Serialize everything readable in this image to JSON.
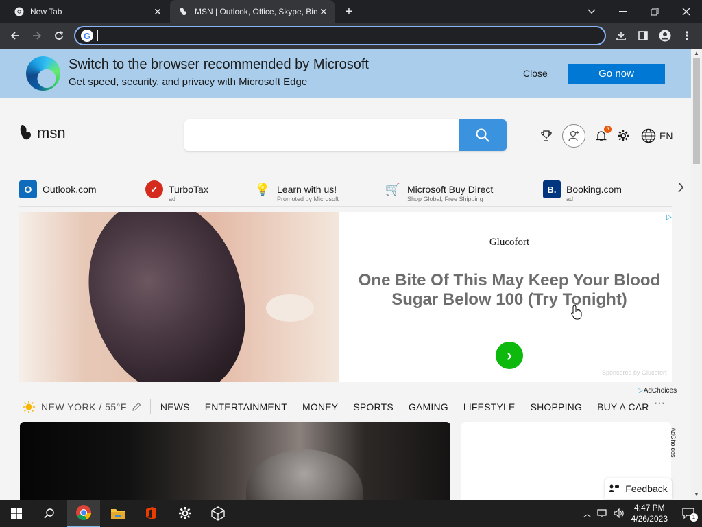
{
  "browser": {
    "tabs": [
      {
        "label": "New Tab",
        "active": false
      },
      {
        "label": "MSN | Outlook, Office, Skype, Bing",
        "active": true
      }
    ],
    "omnibox": {
      "value": "",
      "placeholder": ""
    }
  },
  "edge_banner": {
    "title": "Switch to the browser recommended by Microsoft",
    "subtitle": "Get speed, security, and privacy with Microsoft Edge",
    "close_label": "Close",
    "go_label": "Go now"
  },
  "msn": {
    "logo_text": "msn",
    "search": {
      "value": "",
      "placeholder": ""
    },
    "notification_count": "5",
    "language": "EN"
  },
  "quick_links": [
    {
      "title": "Outlook.com",
      "sub": "",
      "icon_text": "O",
      "icon_color": "#0f6cbd"
    },
    {
      "title": "TurboTax",
      "sub": "ad",
      "icon_text": "✓",
      "icon_color": "#d52b1e"
    },
    {
      "title": "Learn with us!",
      "sub": "Promoted by Microsoft",
      "icon_text": "💡",
      "icon_color": "#f4f4f4"
    },
    {
      "title": "Microsoft Buy Direct",
      "sub": "Shop Global, Free Shipping",
      "icon_text": "🛒",
      "icon_color": "#f4f4f4"
    },
    {
      "title": "Booking.com",
      "sub": "ad",
      "icon_text": "B.",
      "icon_color": "#003580"
    }
  ],
  "ad": {
    "brand": "Glucofort",
    "headline": "One Bite Of This May Keep Your Blood Sugar Below 100 (Try Tonight)",
    "sponsored": "Sponsored by Glucofort",
    "adchoices_label": "AdChoices"
  },
  "weather": {
    "text": "NEW YORK / 55°F"
  },
  "nav_items": [
    "NEWS",
    "ENTERTAINMENT",
    "MONEY",
    "SPORTS",
    "GAMING",
    "LIFESTYLE",
    "SHOPPING",
    "BUY A CAR"
  ],
  "nav_more": "···",
  "sidecard_adchoices": "AdChoices",
  "feedback_label": "Feedback",
  "taskbar": {
    "time": "4:47 PM",
    "date": "4/26/2023",
    "notification_count": "1"
  },
  "colors": {
    "edge_banner_bg": "#a9cdea",
    "go_button": "#0078d4",
    "search_button": "#3b93e0",
    "omnibox_focus": "#8ab4f8",
    "ad_cta": "#0cb90c"
  }
}
